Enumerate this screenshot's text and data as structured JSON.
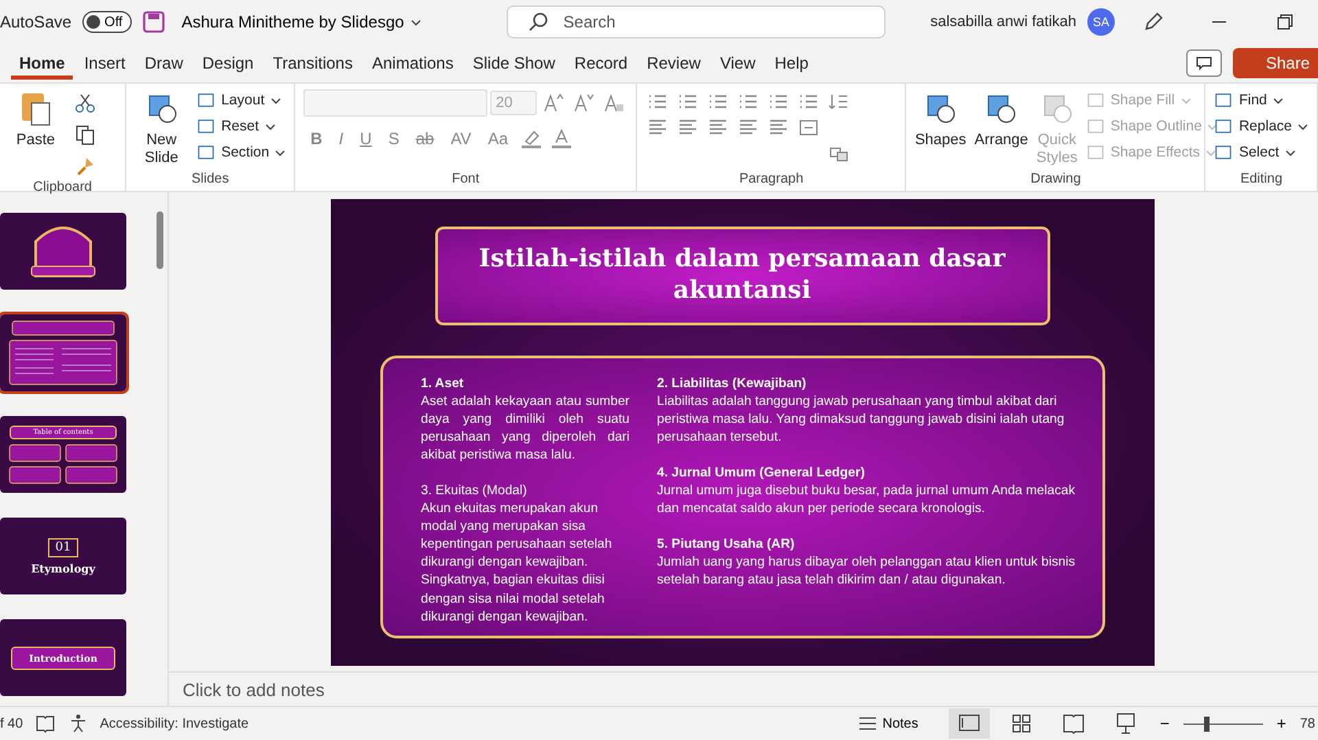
{
  "titlebar": {
    "autosave_label": "AutoSave",
    "autosave": {
      "on": false,
      "label": "Off"
    },
    "document_title": "Ashura Minitheme by Slidesgo",
    "search": {
      "placeholder": "Search"
    },
    "user_name": "salsabilla anwi fatikah",
    "avatar": "SA"
  },
  "tabs": [
    {
      "label": "Home",
      "selected": true
    },
    {
      "label": "Insert",
      "selected": false
    },
    {
      "label": "Draw",
      "selected": false
    },
    {
      "label": "Design",
      "selected": false
    },
    {
      "label": "Transitions",
      "selected": false
    },
    {
      "label": "Animations",
      "selected": false
    },
    {
      "label": "Slide Show",
      "selected": false
    },
    {
      "label": "Record",
      "selected": false
    },
    {
      "label": "Review",
      "selected": false
    },
    {
      "label": "View",
      "selected": false
    },
    {
      "label": "Help",
      "selected": false
    }
  ],
  "share_button": "Share",
  "ribbon": [
    {
      "kind": "clipboard",
      "label": "Clipboard",
      "large": [
        {
          "label": "Paste",
          "disabled": false
        }
      ]
    },
    {
      "kind": "slides",
      "label": "Slides",
      "large": [
        {
          "label": "New Slide",
          "disabled": false
        }
      ],
      "small": [
        {
          "label": "Layout",
          "disabled": false
        },
        {
          "label": "Reset",
          "disabled": false
        },
        {
          "label": "Section",
          "disabled": false
        }
      ]
    },
    {
      "kind": "font",
      "label": "Font",
      "font_size": "20",
      "glyphs": [
        "B",
        "I",
        "U",
        "S",
        "ab",
        "AV",
        "Aa"
      ]
    },
    {
      "kind": "paragraph",
      "label": "Paragraph"
    },
    {
      "kind": "drawing",
      "label": "Drawing",
      "large": [
        {
          "label": "Shapes",
          "disabled": false
        },
        {
          "label": "Arrange",
          "disabled": false
        },
        {
          "label": "Quick Styles",
          "disabled": true
        }
      ],
      "small": [
        {
          "label": "Shape Fill",
          "disabled": true
        },
        {
          "label": "Shape Outline",
          "disabled": true
        },
        {
          "label": "Shape Effects",
          "disabled": true
        }
      ]
    },
    {
      "kind": "editing",
      "label": "Editing",
      "small": [
        {
          "label": "Find",
          "disabled": false
        },
        {
          "label": "Replace",
          "disabled": false
        },
        {
          "label": "Select",
          "disabled": false
        }
      ]
    }
  ],
  "thumbnails": [
    {
      "kind": "cover",
      "selected": false
    },
    {
      "kind": "content",
      "selected": true
    },
    {
      "kind": "toc",
      "selected": false,
      "title": "Table of contents"
    },
    {
      "kind": "section",
      "selected": false,
      "number": "01",
      "title": "Etymology"
    },
    {
      "kind": "intro",
      "selected": false,
      "title": "Introduction"
    }
  ],
  "slide": {
    "title": "Istilah-istilah dalam persamaan dasar akuntansi",
    "columns": [
      [
        {
          "heading": "1. Aset",
          "bold": true,
          "body": "Aset adalah kekayaan atau sumber daya yang dimiliki oleh suatu perusahaan yang diperoleh dari akibat peristiwa masa lalu.",
          "justify": true
        },
        {
          "heading": "3. Ekuitas (Modal)",
          "bold": false,
          "body": "Akun ekuitas merupakan akun modal yang merupakan sisa kepentingan perusahaan setelah dikurangi dengan kewajiban. Singkatnya, bagian ekuitas diisi dengan sisa nilai modal setelah dikurangi dengan kewajiban.",
          "justify": false
        }
      ],
      [
        {
          "heading": "2. Liabilitas (Kewajiban)",
          "bold": true,
          "body": "Liabilitas adalah tanggung jawab perusahaan yang timbul akibat dari peristiwa masa lalu. Yang dimaksud tanggung jawab disini ialah utang perusahaan tersebut.",
          "justify": false
        },
        {
          "heading": "4. Jurnal Umum (General Ledger)",
          "bold": true,
          "body": "Jurnal umum juga disebut buku besar, pada jurnal umum Anda melacak dan mencatat saldo akun per periode secara kronologis.",
          "justify": false
        },
        {
          "heading": "5. Piutang Usaha (AR)",
          "bold": true,
          "body": "Jumlah uang yang harus dibayar oleh pelanggan atau klien untuk bisnis setelah barang atau jasa telah dikirim dan / atau digunakan.",
          "justify": false
        }
      ]
    ]
  },
  "notes_placeholder": "Click to add notes",
  "status_bar": {
    "slide_count": "f 40",
    "accessibility": "Accessibility: Investigate",
    "notes": "Notes",
    "zoom": {
      "minus": "−",
      "plus": "+",
      "level": 0.3,
      "reading": "78"
    }
  }
}
